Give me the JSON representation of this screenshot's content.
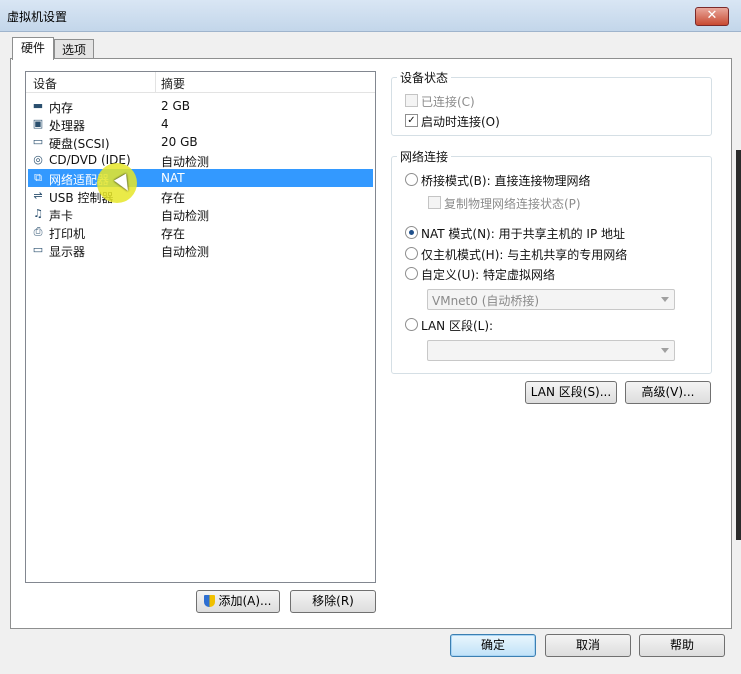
{
  "window": {
    "title": "虚拟机设置",
    "close_glyph": "✕"
  },
  "tabs": [
    {
      "label": "硬件"
    },
    {
      "label": "选项"
    }
  ],
  "device_list": {
    "col_device": "设备",
    "col_summary": "摘要",
    "rows": [
      {
        "name": "内存",
        "summary": "2 GB",
        "icon": "memory-icon"
      },
      {
        "name": "处理器",
        "summary": "4",
        "icon": "processor-icon"
      },
      {
        "name": "硬盘(SCSI)",
        "summary": "20 GB",
        "icon": "hard-disk-icon"
      },
      {
        "name": "CD/DVD (IDE)",
        "summary": "自动检测",
        "icon": "cd-dvd-icon"
      },
      {
        "name": "网络适配器",
        "summary": "NAT",
        "icon": "network-adapter-icon",
        "selected": true
      },
      {
        "name": "USB 控制器",
        "summary": "存在",
        "icon": "usb-icon"
      },
      {
        "name": "声卡",
        "summary": "自动检测",
        "icon": "sound-card-icon"
      },
      {
        "name": "打印机",
        "summary": "存在",
        "icon": "printer-icon"
      },
      {
        "name": "显示器",
        "summary": "自动检测",
        "icon": "display-icon"
      }
    ]
  },
  "buttons": {
    "add": "添加(A)...",
    "remove": "移除(R)",
    "lan_segments": "LAN 区段(S)...",
    "advanced": "高级(V)...",
    "ok": "确定",
    "cancel": "取消",
    "help": "帮助"
  },
  "device_status": {
    "title": "设备状态",
    "connected": {
      "label": "已连接(C)",
      "checked": false,
      "disabled": true
    },
    "connect_at_power_on": {
      "label": "启动时连接(O)",
      "checked": true
    }
  },
  "network_connection": {
    "title": "网络连接",
    "bridged": {
      "label": "桥接模式(B): 直接连接物理网络",
      "selected": false
    },
    "replicate": {
      "label": "复制物理网络连接状态(P)",
      "checked": false,
      "disabled": true
    },
    "nat": {
      "label": "NAT 模式(N): 用于共享主机的 IP 地址",
      "selected": true
    },
    "host_only": {
      "label": "仅主机模式(H): 与主机共享的专用网络",
      "selected": false
    },
    "custom": {
      "label": "自定义(U): 特定虚拟网络",
      "selected": false
    },
    "custom_network_value": "VMnet0 (自动桥接)",
    "lan_segment": {
      "label": "LAN 区段(L):",
      "selected": false
    },
    "lan_segment_value": ""
  },
  "colors": {
    "selection": "#3399ff",
    "accent_border": "#3c7fb1"
  }
}
